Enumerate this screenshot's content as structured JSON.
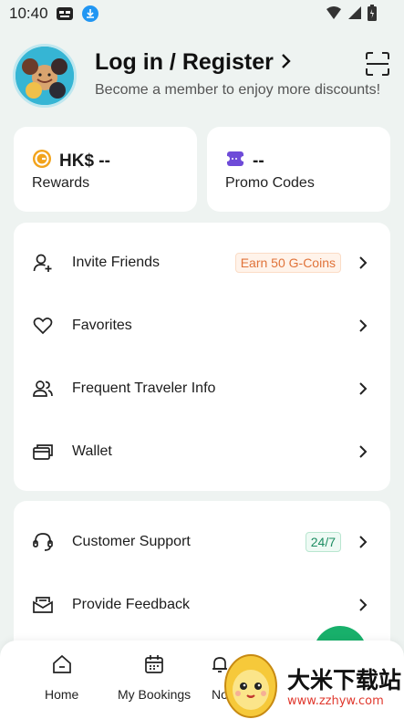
{
  "status_bar": {
    "time": "10:40"
  },
  "header": {
    "title": "Log in / Register",
    "subtitle": "Become a member to enjoy more discounts!"
  },
  "summary_cards": {
    "rewards": {
      "value": "HK$ --",
      "label": "Rewards"
    },
    "promo": {
      "value": "--",
      "label": "Promo Codes"
    }
  },
  "menu_main": [
    {
      "label": "Invite Friends",
      "badge": "Earn 50 G-Coins",
      "icon": "add-user-icon"
    },
    {
      "label": "Favorites",
      "icon": "heart-icon"
    },
    {
      "label": "Frequent Traveler Info",
      "icon": "travelers-icon"
    },
    {
      "label": "Wallet",
      "icon": "wallet-icon"
    }
  ],
  "menu_support": [
    {
      "label": "Customer Support",
      "badge": "24/7",
      "icon": "headset-icon"
    },
    {
      "label": "Provide Feedback",
      "icon": "feedback-icon"
    }
  ],
  "bottom_nav": [
    {
      "label": "Home",
      "icon": "home-icon"
    },
    {
      "label": "My Bookings",
      "icon": "calendar-icon"
    },
    {
      "label": "No",
      "icon": "notification-icon"
    }
  ],
  "watermark": {
    "title": "大米下载站",
    "url": "www.zzhyw.com"
  },
  "colors": {
    "accent": "#18b06b",
    "orange": "#e0733a",
    "background": "#eef3f1"
  }
}
